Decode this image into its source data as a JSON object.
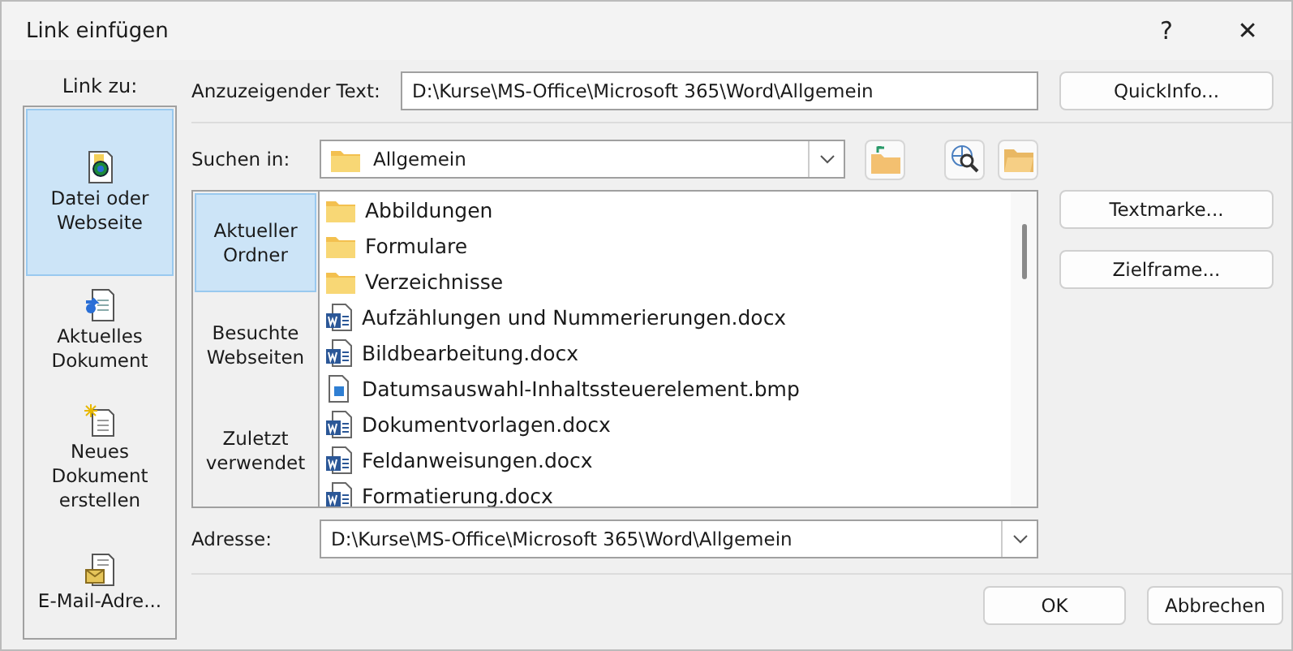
{
  "window": {
    "title": "Link einfügen",
    "help": "?",
    "close": "✕"
  },
  "link_to": {
    "label": "Link zu:",
    "items": [
      {
        "label": "Datei oder Webseite",
        "selected": true
      },
      {
        "label": "Aktuelles Dokument",
        "selected": false
      },
      {
        "label": "Neues Dokument erstellen",
        "selected": false
      },
      {
        "label": "E-Mail-Adre...",
        "selected": false
      }
    ]
  },
  "display_text": {
    "label": "Anzuzeigender Text:",
    "value": "D:\\Kurse\\MS-Office\\Microsoft 365\\Word\\Allgemein"
  },
  "look_in": {
    "label": "Suchen in:",
    "value": "Allgemein"
  },
  "browse_nav": [
    {
      "label": "Aktueller Ordner",
      "selected": true
    },
    {
      "label": "Besuchte Webseiten",
      "selected": false
    },
    {
      "label": "Zuletzt verwendet",
      "selected": false
    }
  ],
  "files": [
    {
      "name": "Abbildungen",
      "kind": "folder"
    },
    {
      "name": "Formulare",
      "kind": "folder"
    },
    {
      "name": "Verzeichnisse",
      "kind": "folder"
    },
    {
      "name": "Aufzählungen und Nummerierungen.docx",
      "kind": "word"
    },
    {
      "name": "Bildbearbeitung.docx",
      "kind": "word"
    },
    {
      "name": "Datumsauswahl-Inhaltssteuerelement.bmp",
      "kind": "image"
    },
    {
      "name": "Dokumentvorlagen.docx",
      "kind": "word"
    },
    {
      "name": "Feldanweisungen.docx",
      "kind": "word"
    },
    {
      "name": "Formatierung.docx",
      "kind": "word"
    }
  ],
  "address": {
    "label": "Adresse:",
    "value": "D:\\Kurse\\MS-Office\\Microsoft 365\\Word\\Allgemein"
  },
  "side_buttons": [
    {
      "label": "QuickInfo..."
    },
    {
      "label": "Textmarke..."
    },
    {
      "label": "Zielframe..."
    }
  ],
  "buttons": [
    {
      "label": "OK"
    },
    {
      "label": "Abbrechen"
    }
  ]
}
